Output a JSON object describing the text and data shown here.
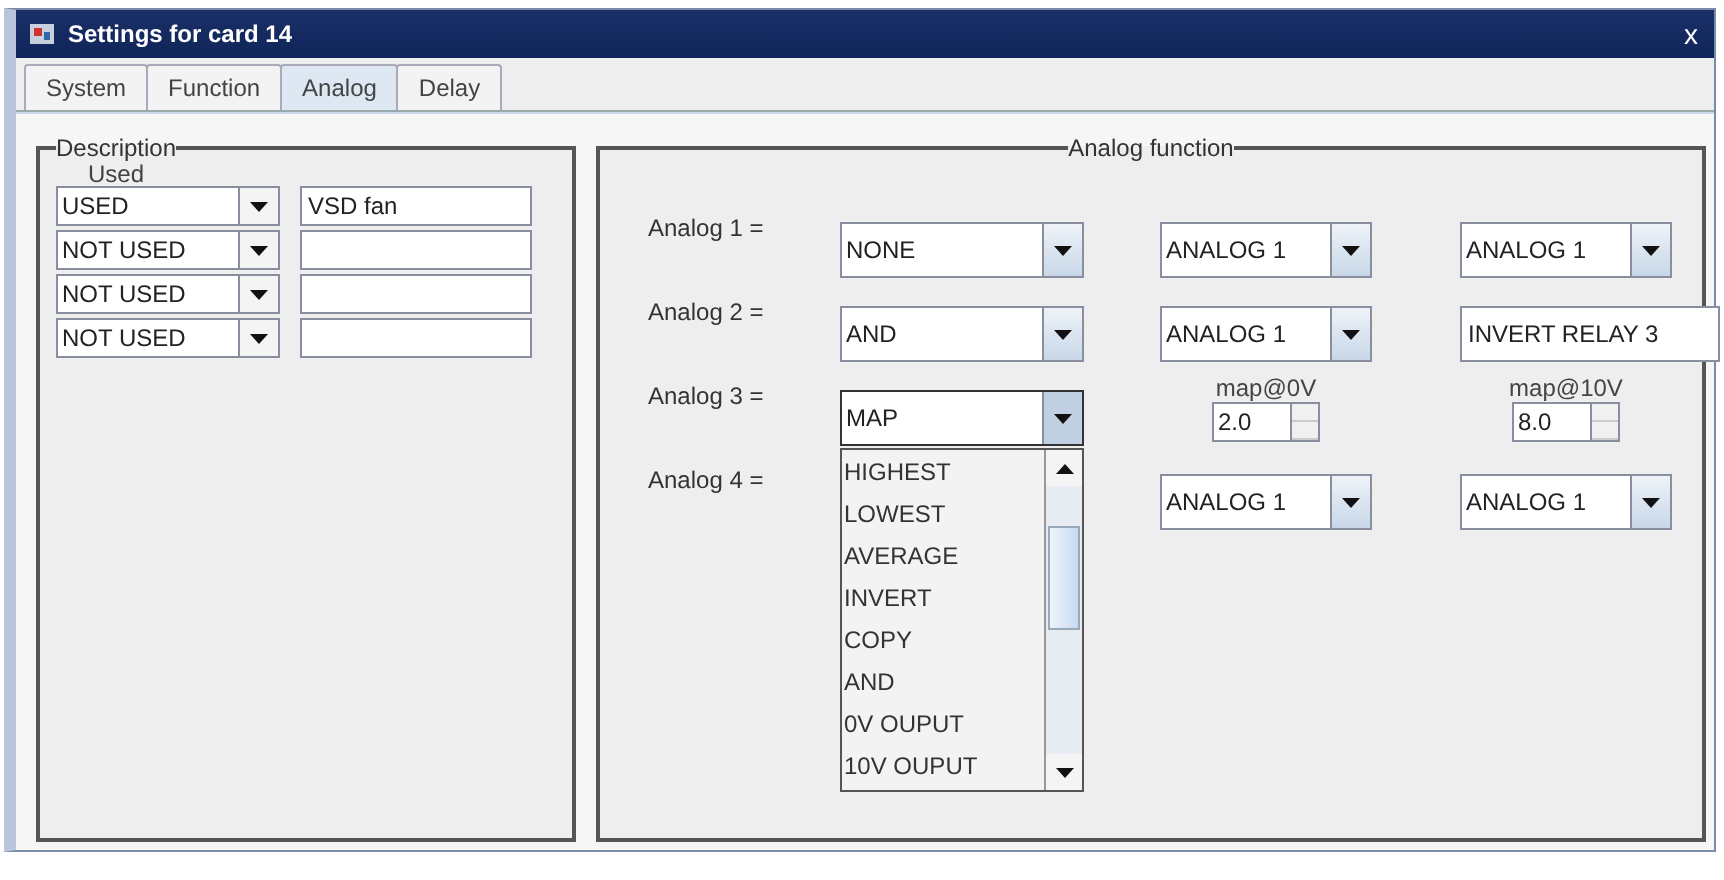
{
  "window": {
    "title": "Settings for card 14",
    "close": "x"
  },
  "tabs": [
    {
      "label": "System",
      "selected": false
    },
    {
      "label": "Function",
      "selected": false
    },
    {
      "label": "Analog",
      "selected": true
    },
    {
      "label": "Delay",
      "selected": false
    }
  ],
  "description_panel": {
    "title": "Description",
    "used_header": "Used",
    "rows": [
      {
        "used": "USED",
        "description": "VSD fan"
      },
      {
        "used": "NOT USED",
        "description": ""
      },
      {
        "used": "NOT USED",
        "description": ""
      },
      {
        "used": "NOT USED",
        "description": ""
      }
    ]
  },
  "analog_panel": {
    "title": "Analog function",
    "rows": [
      {
        "label": "Analog 1 =",
        "function": "NONE",
        "inputs": [
          {
            "kind": "combo",
            "value": "ANALOG 1"
          },
          {
            "kind": "combo",
            "value": "ANALOG 1"
          }
        ]
      },
      {
        "label": "Analog 2 =",
        "function": "AND",
        "inputs": [
          {
            "kind": "combo",
            "value": "ANALOG 1"
          },
          {
            "kind": "text",
            "value": "INVERT RELAY 3"
          }
        ]
      },
      {
        "label": "Analog 3 =",
        "function": "MAP",
        "open": true,
        "inputs": [
          {
            "kind": "spinner",
            "caption": "map@0V",
            "value": "2.0"
          },
          {
            "kind": "spinner",
            "caption": "map@10V",
            "value": "8.0"
          }
        ]
      },
      {
        "label": "Analog 4 =",
        "inputs": [
          {
            "kind": "combo",
            "value": "ANALOG 1"
          },
          {
            "kind": "combo",
            "value": "ANALOG 1"
          }
        ]
      }
    ],
    "open_list": {
      "items": [
        "HIGHEST",
        "LOWEST",
        "AVERAGE",
        "INVERT",
        "COPY",
        "AND",
        "0V OUPUT",
        "10V OUPUT"
      ]
    }
  }
}
